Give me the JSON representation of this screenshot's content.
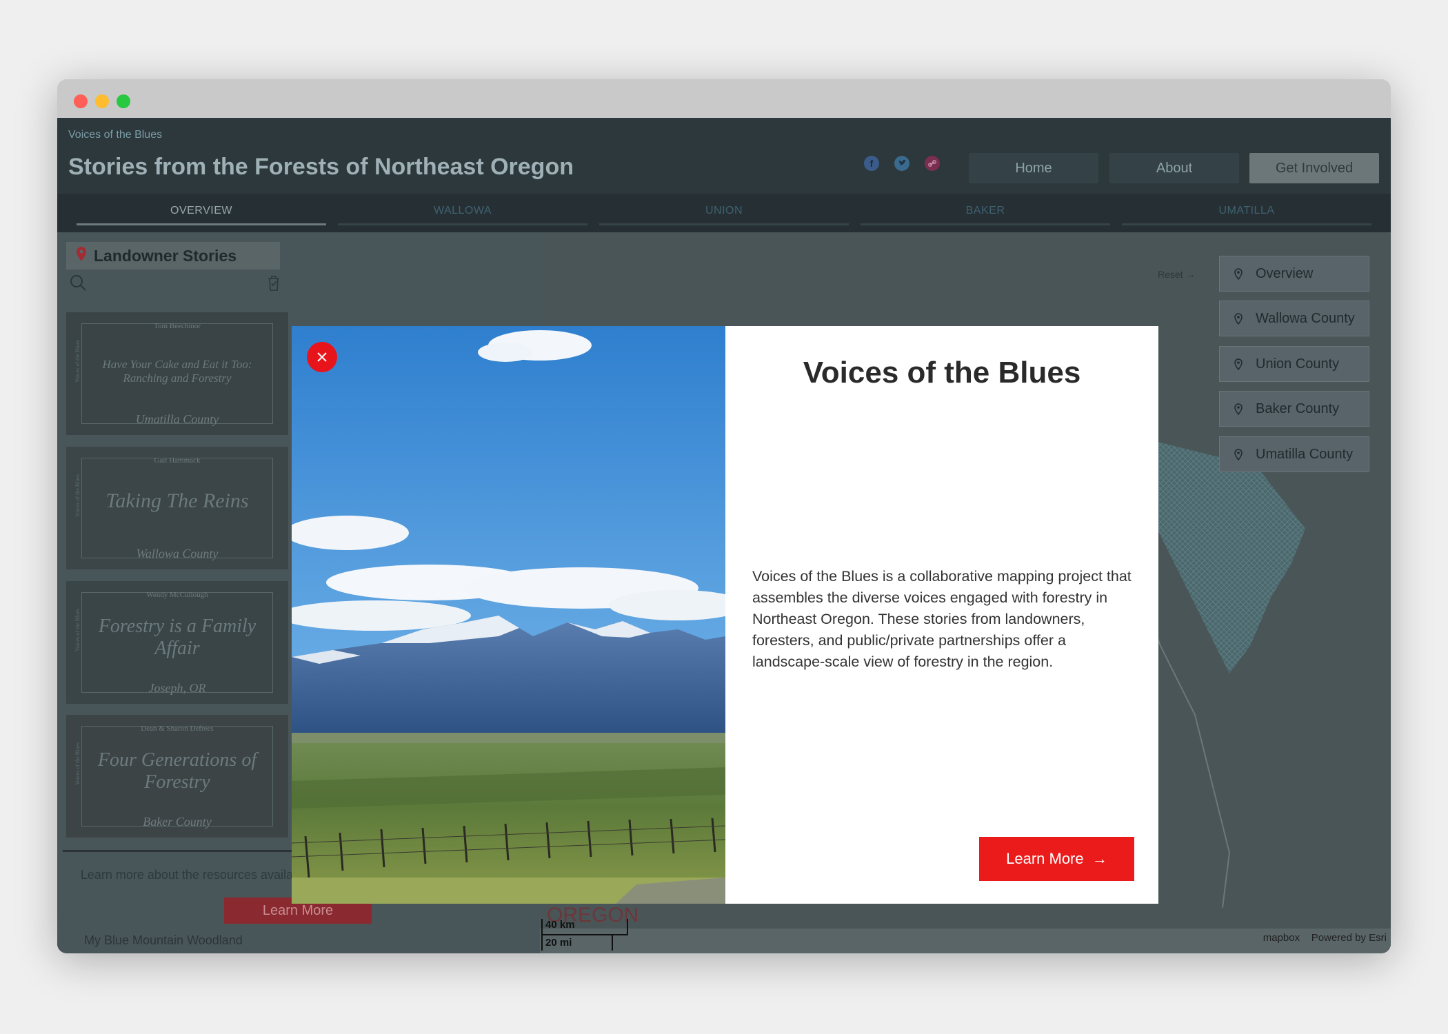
{
  "header": {
    "subtitle": "Voices of the Blues",
    "title": "Stories from the Forests of Northeast Oregon",
    "social_icons": [
      "facebook-icon",
      "twitter-icon",
      "link-icon"
    ],
    "nav": [
      {
        "label": "Home"
      },
      {
        "label": "About"
      },
      {
        "label": "Get Involved"
      }
    ]
  },
  "tabs": [
    {
      "label": "OVERVIEW",
      "active": true
    },
    {
      "label": "WALLOWA"
    },
    {
      "label": "UNION"
    },
    {
      "label": "BAKER"
    },
    {
      "label": "UMATILLA"
    }
  ],
  "sidebar": {
    "heading": "Landowner Stories",
    "cards": [
      {
        "author": "Tom Beechinor",
        "title": "Have Your Cake and Eat it Too: Ranching and Forestry",
        "place": "Umatilla County",
        "side": "Voices of the Blues"
      },
      {
        "author": "Gail Hammack",
        "title": "Taking The Reins",
        "place": "Wallowa County",
        "side": "Voices of the Blues"
      },
      {
        "author": "Wendy McCullough",
        "title": "Forestry is a Family Affair",
        "place": "Joseph, OR",
        "side": "Voices of the Blues"
      },
      {
        "author": "Dean & Sharon Defrees",
        "title": "Four Generations of Forestry",
        "place": "Baker County",
        "side": "Voices of the Blues"
      }
    ],
    "resources_text": "Learn more about the resources available to Landowners in Northeast Oregon",
    "learn_more": "Learn More",
    "footer": "My Blue Mountain Woodland"
  },
  "map": {
    "reset": "Reset",
    "counties": [
      "Overview",
      "Wallowa County",
      "Union County",
      "Baker County",
      "Umatilla County"
    ],
    "scale_km": "40 km",
    "scale_mi": "20 mi",
    "attribution_mapbox": "mapbox",
    "attribution_esri": "Powered by Esri"
  },
  "modal": {
    "title": "Voices of the Blues",
    "body": "Voices of the Blues is a collaborative mapping project that assembles the diverse voices engaged with forestry in Northeast Oregon. These stories from landowners, foresters, and public/private partnerships offer a landscape-scale view of forestry in the region.",
    "learn_more": "Learn More",
    "close_icon": "close-icon"
  },
  "colors": {
    "accent_red": "#ec1b1b",
    "header_bg": "#2c383c"
  }
}
